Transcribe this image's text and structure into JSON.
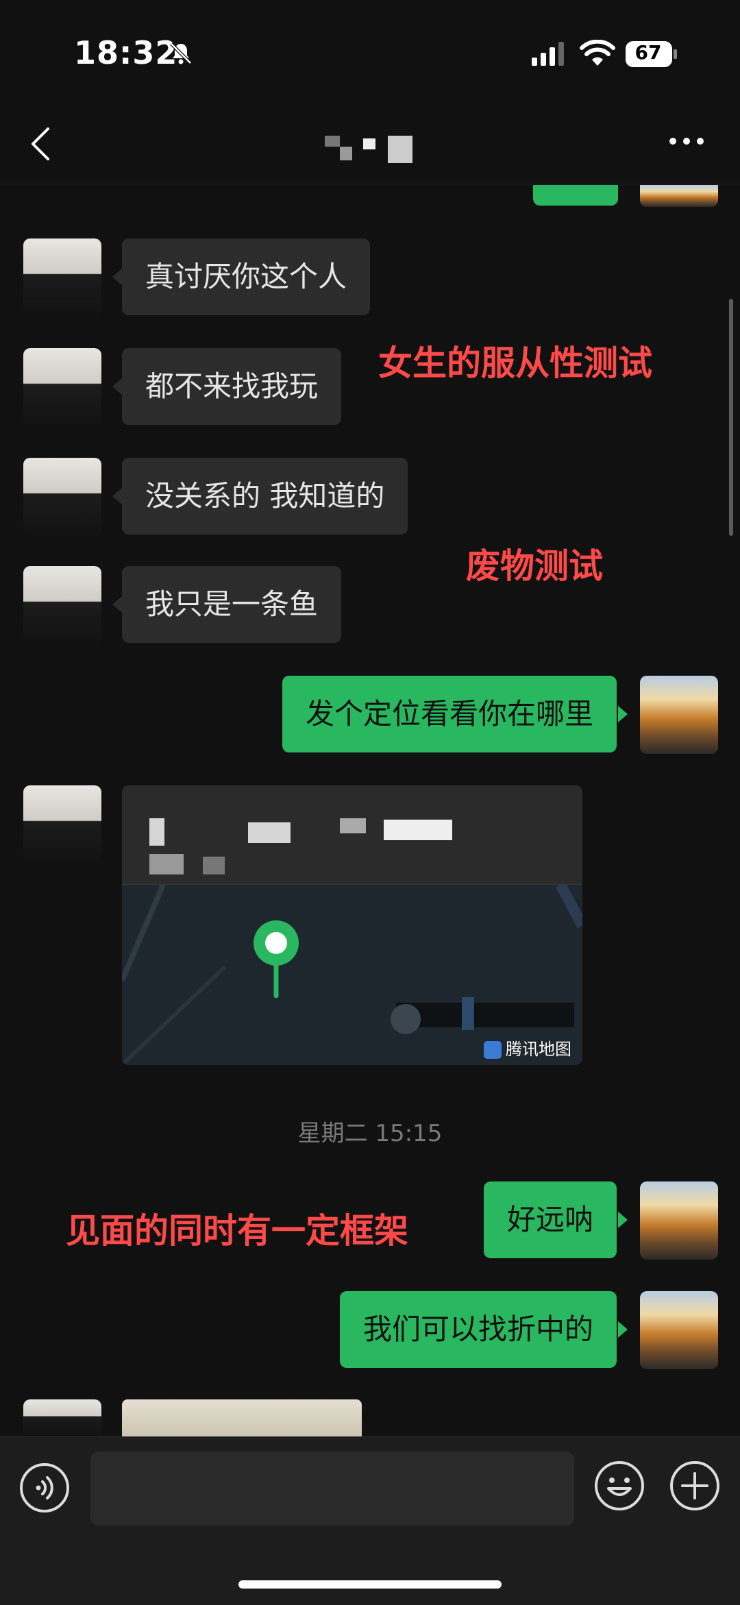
{
  "status_bar": {
    "time": "18:32",
    "battery": "67"
  },
  "nav": {
    "title_blurred": true
  },
  "messages": [
    {
      "side": "in",
      "text": "真讨厌你这个人"
    },
    {
      "side": "in",
      "text": "都不来找我玩"
    },
    {
      "side": "in",
      "text": "没关系的 我知道的"
    },
    {
      "side": "in",
      "text": "我只是一条鱼"
    },
    {
      "side": "out",
      "text": "发个定位看看你在哪里"
    },
    {
      "side": "out",
      "text": "好远呐"
    },
    {
      "side": "out",
      "text": "我们可以找折中的"
    }
  ],
  "location_card": {
    "map_brand": "腾讯地图"
  },
  "time_divider": "星期二 15:15",
  "annotations": [
    "女生的服从性测试",
    "废物测试",
    "见面的同时有一定框架"
  ],
  "colors": {
    "outgoing_bubble": "#29b760",
    "incoming_bubble": "#2c2c2c",
    "annotation": "#ff4a4a",
    "background": "#111111"
  },
  "icons": [
    "bell-mute-icon",
    "signal-icon",
    "wifi-icon",
    "battery-icon",
    "back-icon",
    "more-icon",
    "location-pin-icon",
    "voice-icon",
    "emoji-icon",
    "plus-icon"
  ]
}
